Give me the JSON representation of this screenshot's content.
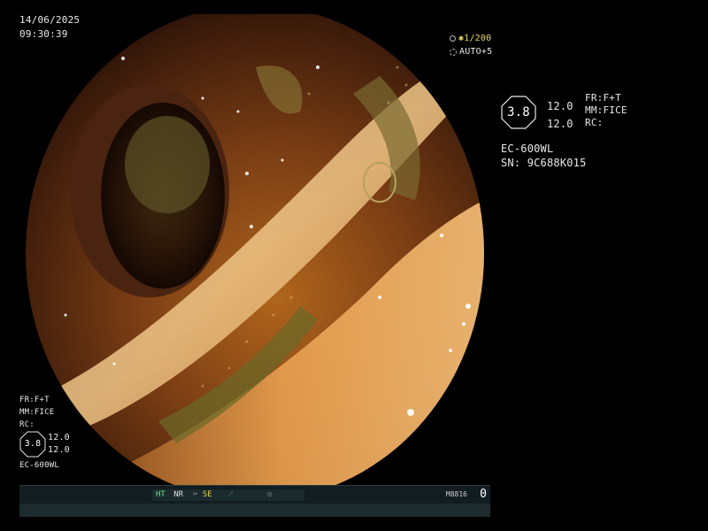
{
  "header": {
    "date": "14/06/2025",
    "time": "09:30:39"
  },
  "zoom": {
    "ratio": "1/200",
    "auto": "AUTO+5",
    "accent_color": "#e8d86a"
  },
  "settings_right": {
    "octagon_value": "3.8",
    "gain_1": "12.0",
    "gain_2": "12.0",
    "fr": "FR:F+T",
    "mm": "MM:FICE",
    "rc": "RC:",
    "scope_model": "EC-600WL",
    "serial": "SN: 9C688K015"
  },
  "settings_left": {
    "fr": "FR:F+T",
    "mm": "MM:FICE",
    "rc": "RC:",
    "octagon_value": "3.8",
    "gain_1": "12.0",
    "gain_2": "12.0",
    "scope_model": "EC-600WL"
  },
  "statusbar": {
    "ht": "HT",
    "nr": "NR",
    "se": "SE",
    "device_id": "M8816",
    "counter": "0",
    "active_color": "#6ce08a",
    "highlight_color": "#e5d74f"
  },
  "icons": [
    "zoom-circle-icon",
    "auto-gear-icon",
    "scissors-icon",
    "slash-icon",
    "camera-circle-icon"
  ]
}
